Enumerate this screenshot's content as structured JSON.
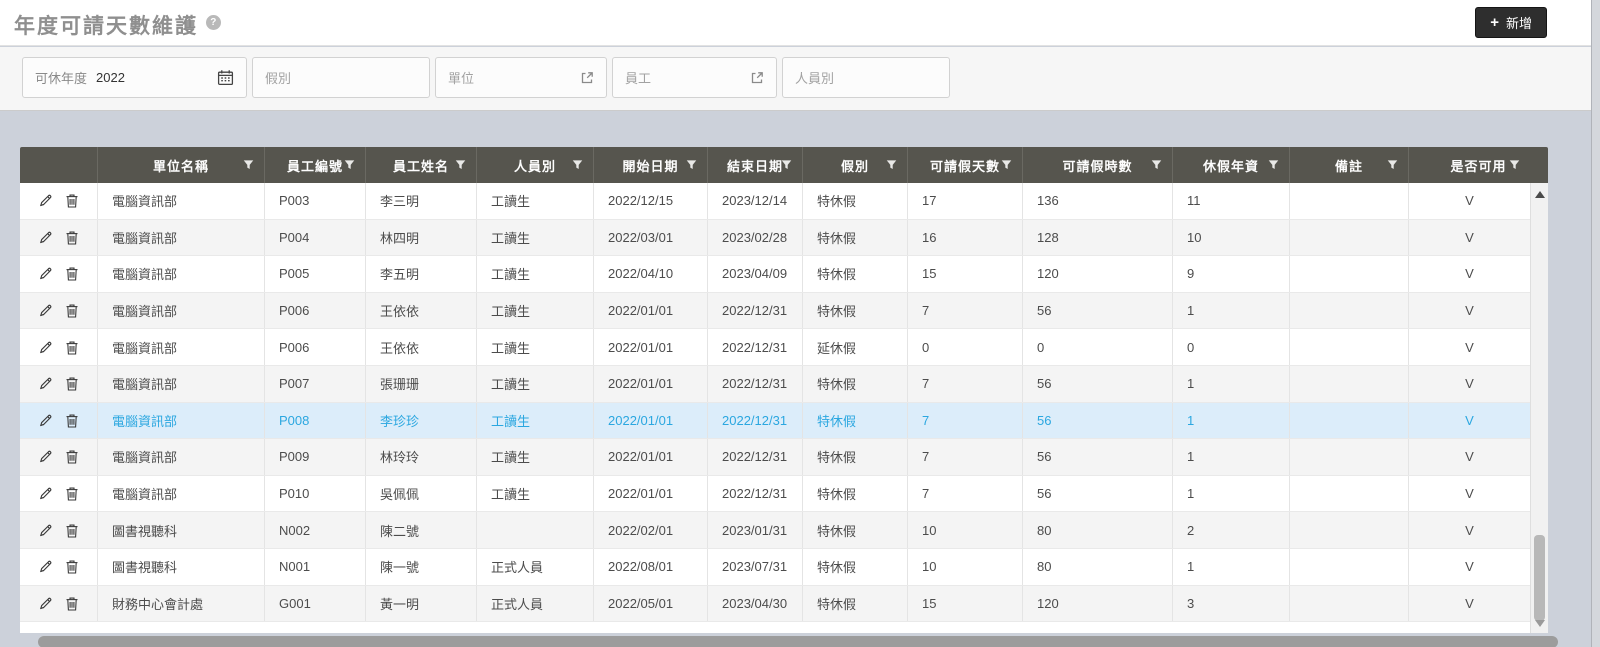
{
  "page": {
    "title": "年度可請天數維護",
    "help": "?"
  },
  "toolbar": {
    "add_plus": "+",
    "add_label": "新增"
  },
  "filters": {
    "year": {
      "label": "可休年度",
      "value": "2022",
      "icon": "calendar-icon"
    },
    "leave": {
      "placeholder": "假別"
    },
    "unit": {
      "placeholder": "單位",
      "icon": "popup-icon"
    },
    "emp": {
      "placeholder": "員工",
      "icon": "popup-icon"
    },
    "ptype": {
      "placeholder": "人員別"
    }
  },
  "table": {
    "columns": [
      "單位名稱",
      "員工編號",
      "員工姓名",
      "人員別",
      "開始日期",
      "結束日期",
      "假別",
      "可請假天數",
      "可請假時數",
      "休假年資",
      "備註",
      "是否可用"
    ],
    "rows": [
      {
        "highlighted": false,
        "cells": [
          "電腦資訊部",
          "P003",
          "李三明",
          "工讀生",
          "2022/12/15",
          "2023/12/14",
          "特休假",
          "17",
          "136",
          "11",
          "",
          "V"
        ]
      },
      {
        "highlighted": false,
        "cells": [
          "電腦資訊部",
          "P004",
          "林四明",
          "工讀生",
          "2022/03/01",
          "2023/02/28",
          "特休假",
          "16",
          "128",
          "10",
          "",
          "V"
        ]
      },
      {
        "highlighted": false,
        "cells": [
          "電腦資訊部",
          "P005",
          "李五明",
          "工讀生",
          "2022/04/10",
          "2023/04/09",
          "特休假",
          "15",
          "120",
          "9",
          "",
          "V"
        ]
      },
      {
        "highlighted": false,
        "cells": [
          "電腦資訊部",
          "P006",
          "王依依",
          "工讀生",
          "2022/01/01",
          "2022/12/31",
          "特休假",
          "7",
          "56",
          "1",
          "",
          "V"
        ]
      },
      {
        "highlighted": false,
        "cells": [
          "電腦資訊部",
          "P006",
          "王依依",
          "工讀生",
          "2022/01/01",
          "2022/12/31",
          "延休假",
          "0",
          "0",
          "0",
          "",
          "V"
        ]
      },
      {
        "highlighted": false,
        "cells": [
          "電腦資訊部",
          "P007",
          "張珊珊",
          "工讀生",
          "2022/01/01",
          "2022/12/31",
          "特休假",
          "7",
          "56",
          "1",
          "",
          "V"
        ]
      },
      {
        "highlighted": true,
        "cells": [
          "電腦資訊部",
          "P008",
          "李珍珍",
          "工讀生",
          "2022/01/01",
          "2022/12/31",
          "特休假",
          "7",
          "56",
          "1",
          "",
          "V"
        ]
      },
      {
        "highlighted": false,
        "cells": [
          "電腦資訊部",
          "P009",
          "林玲玲",
          "工讀生",
          "2022/01/01",
          "2022/12/31",
          "特休假",
          "7",
          "56",
          "1",
          "",
          "V"
        ]
      },
      {
        "highlighted": false,
        "cells": [
          "電腦資訊部",
          "P010",
          "吳佩佩",
          "工讀生",
          "2022/01/01",
          "2022/12/31",
          "特休假",
          "7",
          "56",
          "1",
          "",
          "V"
        ]
      },
      {
        "highlighted": false,
        "cells": [
          "圖書視聽科",
          "N002",
          "陳二號",
          "",
          "2022/02/01",
          "2023/01/31",
          "特休假",
          "10",
          "80",
          "2",
          "",
          "V"
        ]
      },
      {
        "highlighted": false,
        "cells": [
          "圖書視聽科",
          "N001",
          "陳一號",
          "正式人員",
          "2022/08/01",
          "2023/07/31",
          "特休假",
          "10",
          "80",
          "1",
          "",
          "V"
        ]
      },
      {
        "highlighted": false,
        "cells": [
          "財務中心會計處",
          "G001",
          "黃一明",
          "正式人員",
          "2022/05/01",
          "2023/04/30",
          "特休假",
          "15",
          "120",
          "3",
          "",
          "V"
        ]
      }
    ]
  },
  "colors": {
    "header_bg": "#56554e",
    "highlight_bg": "#dcedfa",
    "highlight_text": "#2ba7e0",
    "stripe_bg": "#f4f4f4",
    "add_button_bg": "#2e2e2e"
  }
}
